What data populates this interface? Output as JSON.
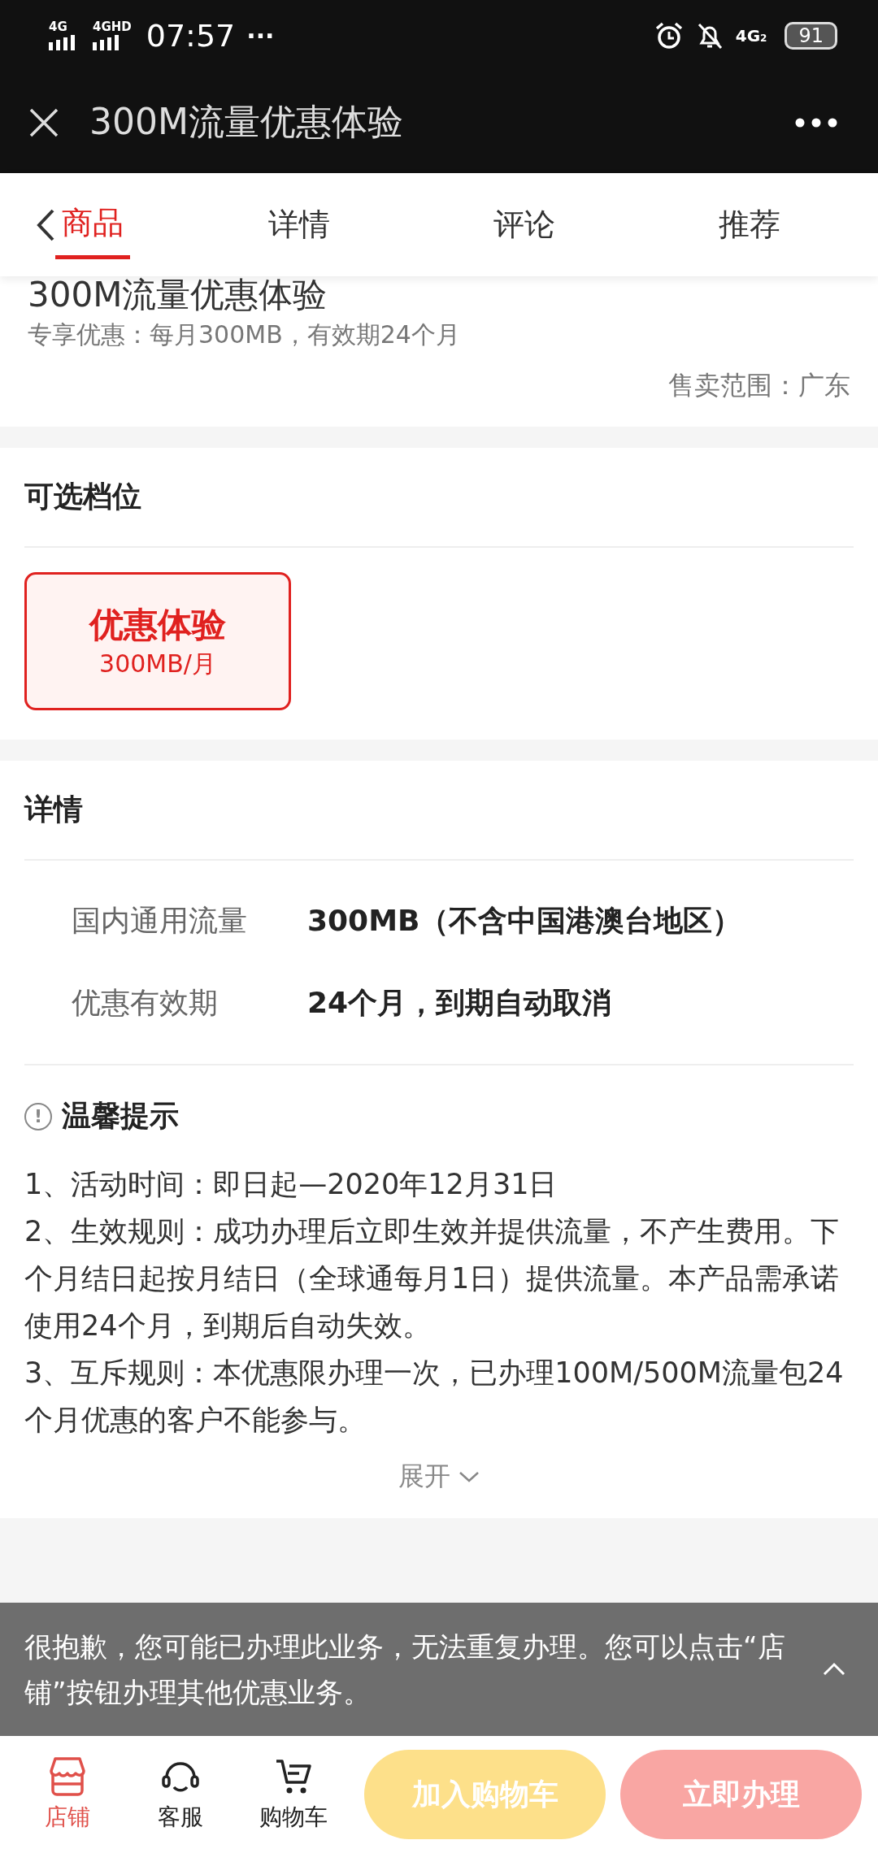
{
  "status_bar": {
    "network_1": "4G",
    "network_2": "4GHD",
    "time": "07:57",
    "more": "···",
    "network_3": "4G",
    "sim": "2",
    "battery": "91"
  },
  "title_bar": {
    "title": "300M流量优惠体验"
  },
  "tabs": [
    {
      "label": "商品",
      "selected": true
    },
    {
      "label": "详情",
      "selected": false
    },
    {
      "label": "评论",
      "selected": false
    },
    {
      "label": "推荐",
      "selected": false
    }
  ],
  "product": {
    "title": "300M流量优惠体验",
    "subtitle": "专享优惠：每月300MB，有效期24个月",
    "sale_area": "售卖范围：广东"
  },
  "options": {
    "heading": "可选档位",
    "items": [
      {
        "name": "优惠体验",
        "spec": "300MB/月",
        "selected": true
      }
    ]
  },
  "details": {
    "heading": "详情",
    "rows": [
      {
        "label": "国内通用流量",
        "value": "300MB（不含中国港澳台地区）"
      },
      {
        "label": "优惠有效期",
        "value": "24个月，到期自动取消"
      }
    ],
    "notice_heading": "温馨提示",
    "notice_icon": "!",
    "notice": [
      "1、活动时间：即日起—2020年12月31日",
      "2、生效规则：成功办理后立即生效并提供流量，不产生费用。下个月结日起按月结日（全球通每月1日）提供流量。本产品需承诺使用24个月，到期后自动失效。",
      "3、互斥规则：本优惠限办理一次，已办理100M/500M流量包24个月优惠的客户不能参与。"
    ],
    "expand": "展开"
  },
  "toast": {
    "message": "很抱歉，您可能已办理此业务，无法重复办理。您可以点击“店铺”按钮办理其他优惠业务。"
  },
  "bottom_bar": {
    "items": [
      {
        "kind": "shop",
        "label": "店铺",
        "selected": true
      },
      {
        "kind": "service",
        "label": "客服",
        "selected": false
      },
      {
        "kind": "cart",
        "label": "购物车",
        "selected": false
      }
    ],
    "add_to_cart": "加入购物车",
    "buy_now": "立即办理"
  }
}
